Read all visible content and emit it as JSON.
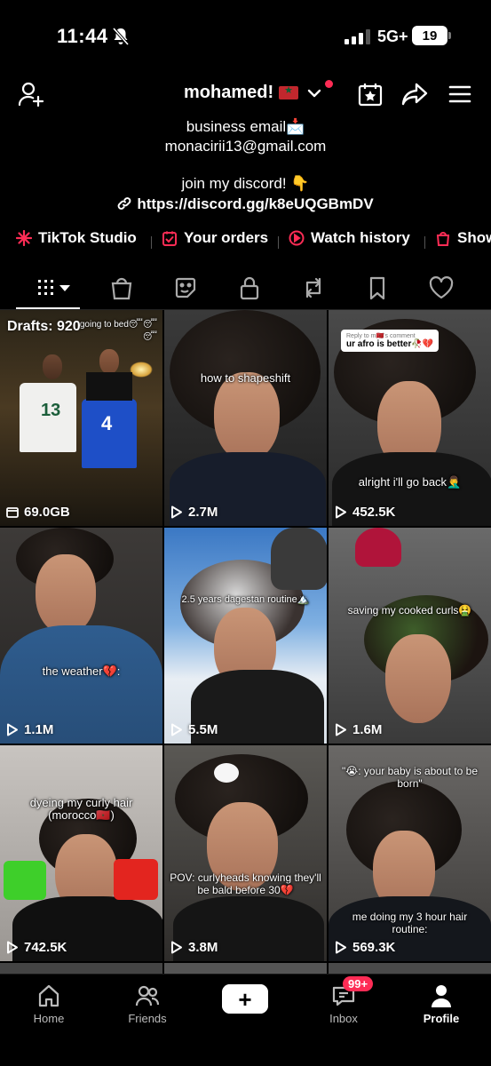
{
  "status_bar": {
    "time": "11:44",
    "network": "5G+",
    "battery": "19"
  },
  "header": {
    "username": "mohamed!",
    "flag": "morocco-flag"
  },
  "bio": {
    "line1": "business email📩",
    "line2": "monacirii13@gmail.com",
    "line3": "join my discord! 👇",
    "link": "https://discord.gg/k8eUQGBmDV"
  },
  "shortcuts": [
    {
      "label": "TikTok Studio",
      "icon": "tiktok-studio-icon"
    },
    {
      "label": "Your orders",
      "icon": "orders-icon"
    },
    {
      "label": "Watch history",
      "icon": "watch-history-icon"
    },
    {
      "label": "Show",
      "icon": "shop-icon"
    }
  ],
  "tabs": [
    "videos-grid",
    "shop",
    "sticker",
    "private",
    "reposts",
    "favorites",
    "liked"
  ],
  "grid": [
    {
      "top_caption": "going to bed😴😴😴",
      "drafts": "Drafts: 920",
      "views": "69.0GB",
      "views_icon": "storage-icon"
    },
    {
      "caption": "how to shapeshift",
      "views": "2.7M"
    },
    {
      "reply_top": "Reply to m🇲🇦's comment",
      "reply": "ur afro is better🥀💔",
      "caption": "alright i'll go back🤦‍♂️",
      "views": "452.5K"
    },
    {
      "caption": "the weather💔:",
      "views": "1.1M"
    },
    {
      "caption": "2.5 years dagestan routine🏔️",
      "views": "5.5M"
    },
    {
      "caption": "saving my cooked curls🤮",
      "views": "1.6M"
    },
    {
      "caption": "dyeing my curly hair (morocco🇲🇦)",
      "views": "742.5K"
    },
    {
      "caption": "POV: curlyheads knowing they'll be bald before 30💔",
      "views": "3.8M"
    },
    {
      "caption": "\"😭: your baby is about to be born\"",
      "caption2": "me doing my 3 hour hair routine:",
      "views": "569.3K"
    }
  ],
  "bottom_nav": {
    "home": "Home",
    "friends": "Friends",
    "inbox": "Inbox",
    "inbox_badge": "99+",
    "profile": "Profile"
  },
  "colors": {
    "accent": "#fe2c55",
    "cyan": "#25f4ee",
    "background": "#000000"
  }
}
